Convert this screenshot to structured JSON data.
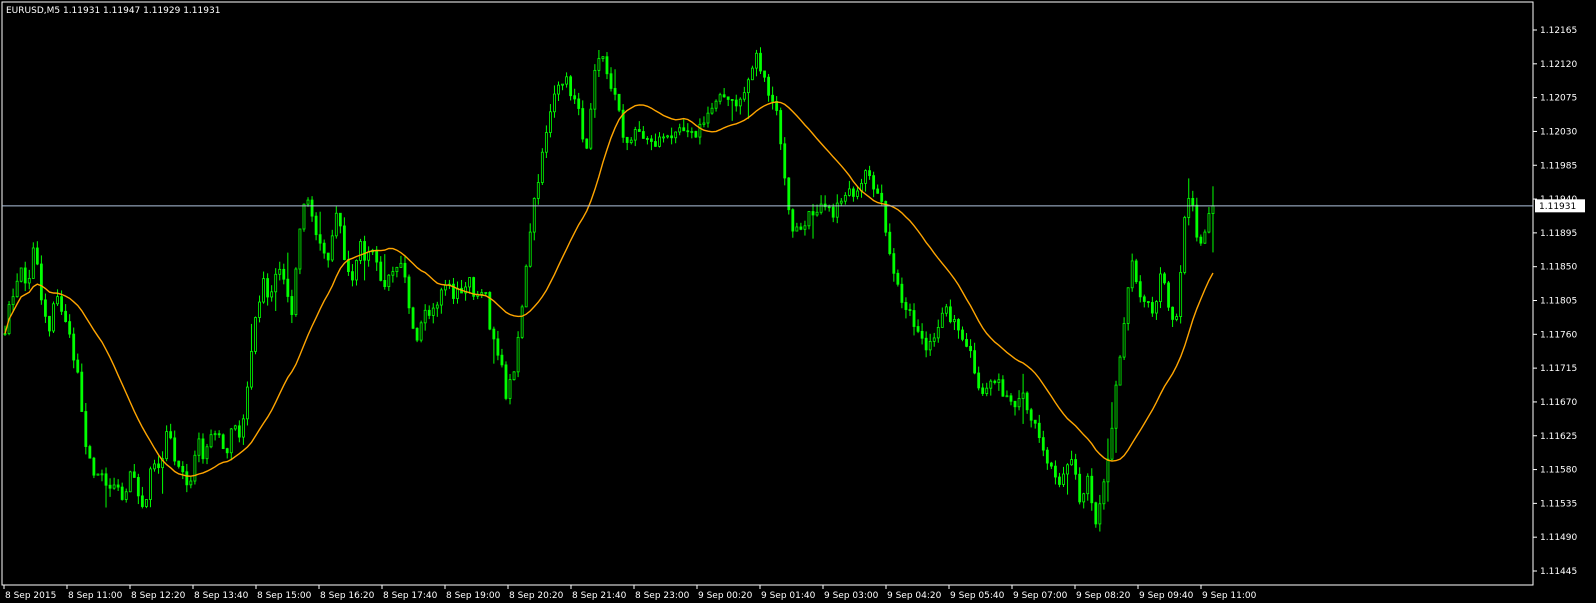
{
  "window": {
    "title": "EURUSD,M5  1.11931 1.11947 1.11929 1.11931"
  },
  "colors": {
    "background": "#000000",
    "frame": "#FFFFFF",
    "candle": "#00FF00",
    "ma": "#FFA500",
    "bid_line": "#B0C4DE",
    "bid_label_bg": "#FFFFFF",
    "bid_label_text": "#000000"
  },
  "chart_data": {
    "type": "candlestick",
    "symbol": "EURUSD",
    "timeframe": "M5",
    "current": {
      "open": 1.11931,
      "high": 1.11947,
      "low": 1.11929,
      "close": 1.11931
    },
    "ylim": [
      1.11445,
      1.12165
    ],
    "y_ticks": [
      "1.12165",
      "1.12120",
      "1.12075",
      "1.12030",
      "1.11985",
      "1.11940",
      "1.11895",
      "1.11850",
      "1.11805",
      "1.11760",
      "1.11715",
      "1.11670",
      "1.11625",
      "1.11580",
      "1.11535",
      "1.11490",
      "1.11445"
    ],
    "x_ticks": [
      "8 Sep 2015",
      "8 Sep 11:00",
      "8 Sep 12:20",
      "8 Sep 13:40",
      "8 Sep 15:00",
      "8 Sep 16:20",
      "8 Sep 17:40",
      "8 Sep 19:00",
      "8 Sep 20:20",
      "8 Sep 21:40",
      "8 Sep 23:00",
      "9 Sep 00:20",
      "9 Sep 01:40",
      "9 Sep 03:00",
      "9 Sep 04:20",
      "9 Sep 05:40",
      "9 Sep 07:00",
      "9 Sep 08:20",
      "9 Sep 09:40",
      "9 Sep 11:00"
    ],
    "bid_price": "1.11931",
    "price_series": [
      1.1177,
      1.1181,
      1.1185,
      1.1182,
      1.1188,
      1.118,
      1.1176,
      1.1182,
      1.1178,
      1.1175,
      1.117,
      1.116,
      1.1158,
      1.1157,
      1.1155,
      1.1156,
      1.1153,
      1.1158,
      1.1155,
      1.1153,
      1.116,
      1.1157,
      1.1163,
      1.116,
      1.1158,
      1.1155,
      1.1162,
      1.116,
      1.1163,
      1.1162,
      1.116,
      1.1165,
      1.1162,
      1.117,
      1.1178,
      1.1183,
      1.118,
      1.1185,
      1.1183,
      1.1178,
      1.119,
      1.1195,
      1.119,
      1.1188,
      1.1185,
      1.1193,
      1.1187,
      1.1183,
      1.1188,
      1.1186,
      1.1188,
      1.1183,
      1.1183,
      1.1184,
      1.1185,
      1.1178,
      1.1176,
      1.118,
      1.1179,
      1.1181,
      1.1183,
      1.1181,
      1.1182,
      1.1183,
      1.1181,
      1.1183,
      1.1175,
      1.1174,
      1.1168,
      1.117,
      1.1178,
      1.1188,
      1.1195,
      1.12,
      1.1205,
      1.121,
      1.121,
      1.1208,
      1.1205,
      1.12,
      1.121,
      1.1213,
      1.121,
      1.1207,
      1.1202,
      1.1202,
      1.1203,
      1.1202,
      1.1201,
      1.1202,
      1.1203,
      1.1202,
      1.1203,
      1.1202,
      1.1203,
      1.1205,
      1.1206,
      1.1207,
      1.1208,
      1.1207,
      1.1207,
      1.121,
      1.1213,
      1.121,
      1.1208,
      1.1205,
      1.1195,
      1.119,
      1.119,
      1.1192,
      1.1191,
      1.1193,
      1.1192,
      1.1193,
      1.1194,
      1.1195,
      1.1196,
      1.1199,
      1.1196,
      1.1193,
      1.1188,
      1.1183,
      1.118,
      1.1178,
      1.1176,
      1.1174,
      1.1176,
      1.1178,
      1.1179,
      1.1177,
      1.1176,
      1.1174,
      1.117,
      1.1168,
      1.117,
      1.1169,
      1.1168,
      1.1167,
      1.1169,
      1.1166,
      1.1163,
      1.116,
      1.1158,
      1.1155,
      1.1158,
      1.116,
      1.1153,
      1.1157,
      1.115,
      1.1155,
      1.116,
      1.117,
      1.1178,
      1.1185,
      1.1182,
      1.118,
      1.1178,
      1.1184,
      1.118,
      1.1177,
      1.119,
      1.1195,
      1.1187,
      1.119,
      1.11931
    ]
  }
}
